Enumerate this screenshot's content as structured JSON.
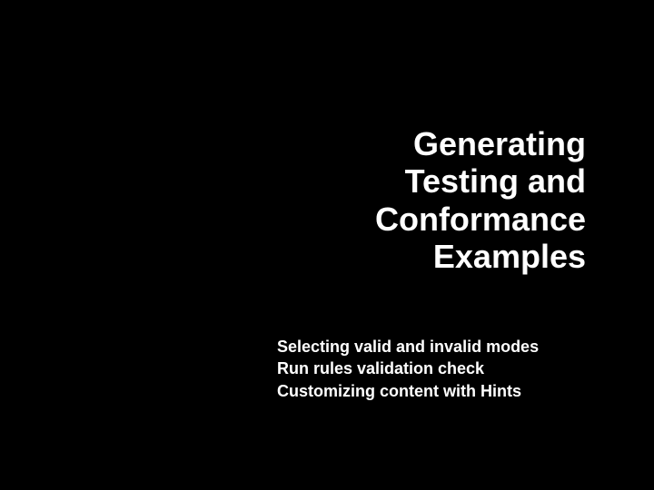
{
  "title": {
    "lines": [
      "Generating",
      "Testing and",
      "Conformance",
      "Examples"
    ]
  },
  "bullets": [
    "Selecting valid and invalid modes",
    "Run rules validation check",
    "Customizing content with Hints"
  ]
}
